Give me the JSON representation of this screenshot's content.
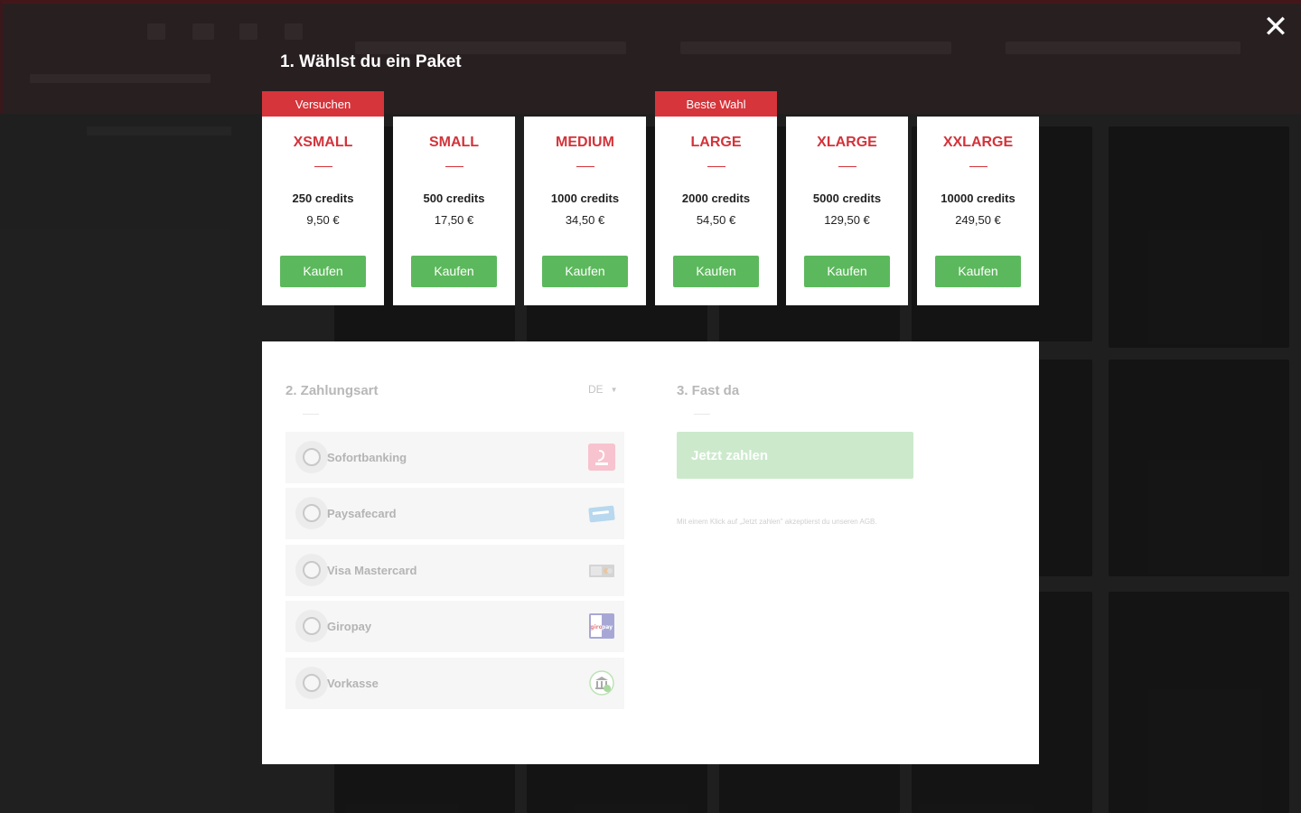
{
  "modal": {
    "close_symbol": "✕",
    "step1_title": "1. Wählst du ein Paket",
    "packages": [
      {
        "tag": "Versuchen",
        "name": "XSMALL",
        "credits": "250 credits",
        "price": "9,50 €",
        "buy_label": "Kaufen"
      },
      {
        "tag": "",
        "name": "SMALL",
        "credits": "500 credits",
        "price": "17,50 €",
        "buy_label": "Kaufen"
      },
      {
        "tag": "",
        "name": "MEDIUM",
        "credits": "1000 credits",
        "price": "34,50 €",
        "buy_label": "Kaufen"
      },
      {
        "tag": "Beste Wahl",
        "name": "LARGE",
        "credits": "2000 credits",
        "price": "54,50 €",
        "buy_label": "Kaufen"
      },
      {
        "tag": "",
        "name": "XLARGE",
        "credits": "5000 credits",
        "price": "129,50 €",
        "buy_label": "Kaufen"
      },
      {
        "tag": "",
        "name": "XXLARGE",
        "credits": "10000 credits",
        "price": "249,50 €",
        "buy_label": "Kaufen"
      }
    ],
    "step2_title": "2. Zahlungsart",
    "language": "DE",
    "payment_methods": [
      {
        "label": "Sofortbanking",
        "icon": "sofort-logo"
      },
      {
        "label": "Paysafecard",
        "icon": "paysafecard-logo"
      },
      {
        "label": "Visa Mastercard",
        "icon": "credit-card-logo"
      },
      {
        "label": "Giropay",
        "icon": "giropay-logo"
      },
      {
        "label": "Vorkasse",
        "icon": "bank-transfer-logo"
      }
    ],
    "step3_title": "3. Fast da",
    "pay_label": "Jetzt zahlen",
    "terms_text": "Mit einem Klick auf „Jetzt zahlen\" akzeptierst du unseren AGB."
  },
  "colors": {
    "accent_red": "#d3333a",
    "buy_green": "#5cb85c",
    "pay_green_disabled": "#cce9cc"
  }
}
